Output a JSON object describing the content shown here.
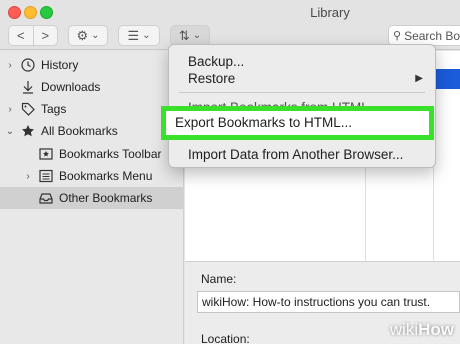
{
  "window": {
    "title": "Library"
  },
  "toolbar": {
    "back_glyph": "<",
    "forward_glyph": ">",
    "gear_glyph": "⚙",
    "dropdown_glyph": "⌄",
    "view_glyph": "☰",
    "sort_glyph": "⇅",
    "search_placeholder": "Search Bo"
  },
  "sidebar": {
    "items": [
      {
        "label": "History",
        "icon": "clock-icon",
        "chevron": "›"
      },
      {
        "label": "Downloads",
        "icon": "download-icon",
        "chevron": ""
      },
      {
        "label": "Tags",
        "icon": "tag-icon",
        "chevron": "›"
      },
      {
        "label": "All Bookmarks",
        "icon": "star-icon",
        "chevron": "⌄"
      },
      {
        "label": "Bookmarks Toolbar",
        "icon": "toolbar-star-icon",
        "chevron": ""
      },
      {
        "label": "Bookmarks Menu",
        "icon": "menu-list-icon",
        "chevron": "›"
      },
      {
        "label": "Other Bookmarks",
        "icon": "tray-icon",
        "chevron": ""
      }
    ]
  },
  "menu": {
    "items": [
      {
        "label": "Backup..."
      },
      {
        "label": "Restore",
        "submenu": "▶"
      },
      {
        "label": "Import Bookmarks from HTML..."
      },
      {
        "label": "Export Bookmarks to HTML..."
      },
      {
        "label": "Import Data from Another Browser..."
      }
    ]
  },
  "detail": {
    "name_label": "Name:",
    "name_value": "wikiHow: How-to instructions you can trust.",
    "location_label": "Location:"
  },
  "watermark": {
    "wiki": "wiki",
    "how": "How"
  },
  "colors": {
    "highlight": "#39e12b",
    "selection": "#1a5cd9"
  }
}
